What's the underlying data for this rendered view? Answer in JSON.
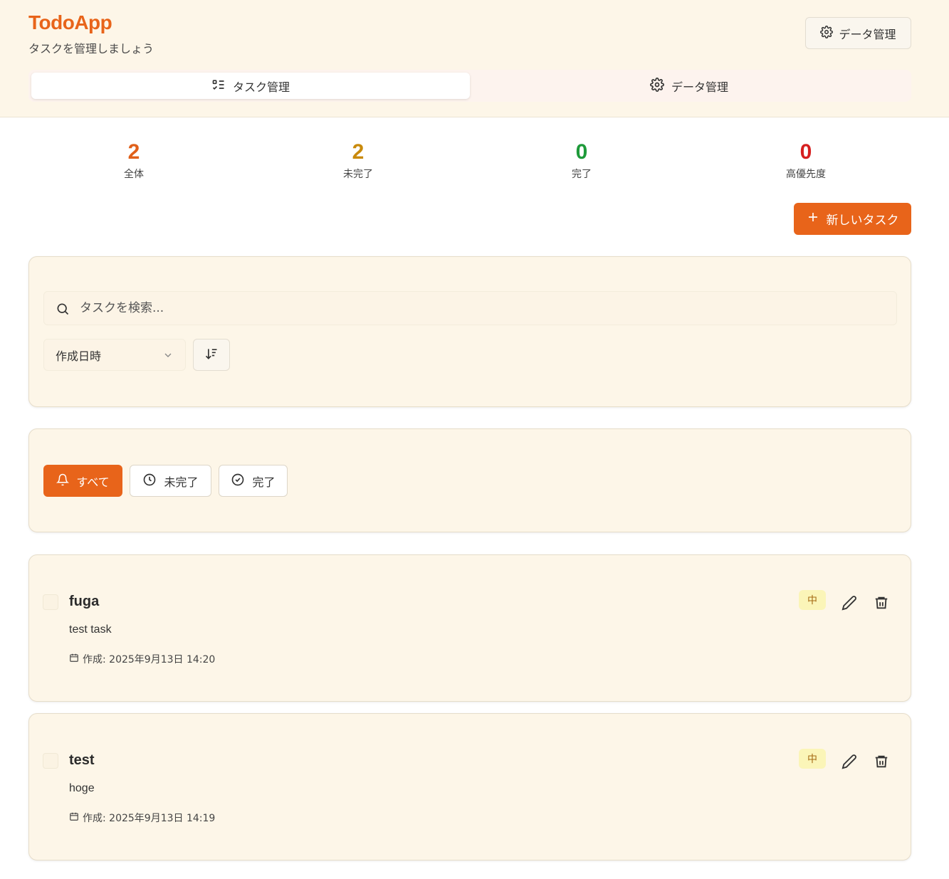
{
  "header": {
    "title": "TodoApp",
    "subtitle": "タスクを管理しましょう",
    "data_button": "データ管理"
  },
  "tabs": [
    {
      "label": "タスク管理",
      "active": true
    },
    {
      "label": "データ管理",
      "active": false
    }
  ],
  "stats": [
    {
      "value": "2",
      "label": "全体",
      "color": "#e0601a"
    },
    {
      "value": "2",
      "label": "未完了",
      "color": "#c98a0c"
    },
    {
      "value": "0",
      "label": "完了",
      "color": "#1e9a3a"
    },
    {
      "value": "0",
      "label": "高優先度",
      "color": "#d61f1f"
    }
  ],
  "new_task_button": "新しいタスク",
  "search": {
    "placeholder": "タスクを検索..."
  },
  "sort": {
    "selected": "作成日時"
  },
  "filters": [
    {
      "label": "すべて",
      "active": true
    },
    {
      "label": "未完了",
      "active": false
    },
    {
      "label": "完了",
      "active": false
    }
  ],
  "tasks": [
    {
      "title": "fuga",
      "description": "test task",
      "created": "作成: 2025年9月13日 14:20",
      "priority": "中"
    },
    {
      "title": "test",
      "description": "hoge",
      "created": "作成: 2025年9月13日 14:19",
      "priority": "中"
    }
  ],
  "colors": {
    "accent": "#e8641a",
    "background": "#fdf6e8",
    "badge": "#fbf5b8"
  }
}
